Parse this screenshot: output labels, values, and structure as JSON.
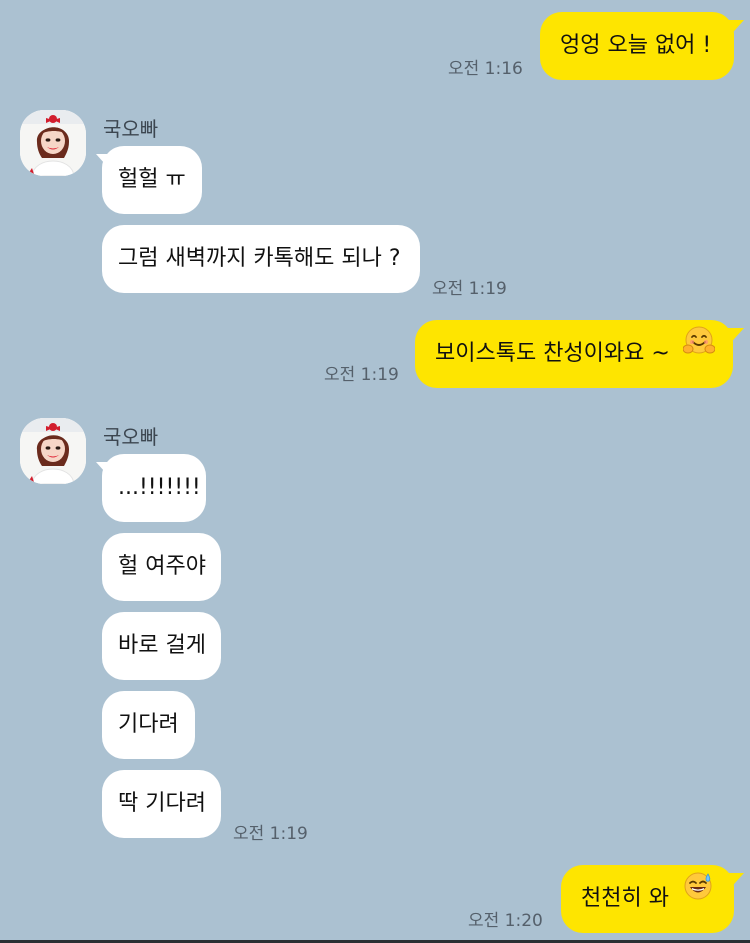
{
  "colors": {
    "background": "#abc1d1",
    "incoming_bubble": "#ffffff",
    "outgoing_bubble": "#fee500",
    "timestamp": "#55606b"
  },
  "messages": {
    "m1": {
      "text": "엉엉 오늘 없어 !",
      "time": "오전 1:16"
    },
    "group1": {
      "sender": "국오빠",
      "m2": {
        "text": "헐헐 ㅠ"
      },
      "m3": {
        "text": "그럼 새벽까지 카톡해도 되나 ?",
        "time": "오전 1:19"
      }
    },
    "m4": {
      "text": "보이스톡도 찬성이와요 ~",
      "time": "오전 1:19",
      "emoji": "hugging-face-icon"
    },
    "group2": {
      "sender": "국오빠",
      "m5": {
        "text": "...!!!!!!!"
      },
      "m6": {
        "text": "헐 여주야"
      },
      "m7": {
        "text": "바로 걸게"
      },
      "m8": {
        "text": "기다려"
      },
      "m9": {
        "text": "딱 기다려",
        "time": "오전 1:19"
      }
    },
    "m10": {
      "text": "천천히 와",
      "time": "오전 1:20",
      "emoji": "sweat-smile-icon"
    }
  }
}
